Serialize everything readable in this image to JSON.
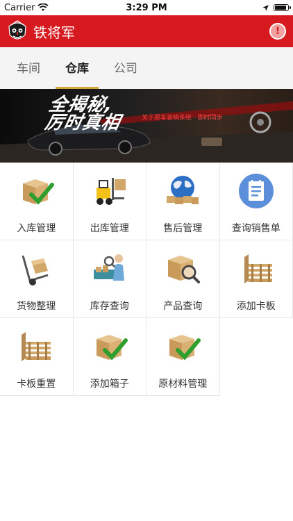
{
  "status_bar": {
    "carrier": "Carrier",
    "time": "3:29 PM"
  },
  "header": {
    "title": "铁将军",
    "alert_label": "!"
  },
  "tabs": [
    {
      "label": "车间"
    },
    {
      "label": "仓库"
    },
    {
      "label": "公司"
    }
  ],
  "banner": {
    "headline_line1": "全揭秘,",
    "headline_line2": "厉时真相",
    "subtext": "关于原车音响系统 · 即时同步"
  },
  "menu": {
    "items": [
      {
        "label": "入库管理",
        "icon": "box-check-icon"
      },
      {
        "label": "出库管理",
        "icon": "forklift-icon"
      },
      {
        "label": "售后管理",
        "icon": "globe-boxes-icon"
      },
      {
        "label": "查询销售单",
        "icon": "document-icon"
      },
      {
        "label": "货物整理",
        "icon": "hand-truck-icon"
      },
      {
        "label": "库存查询",
        "icon": "inventory-person-icon"
      },
      {
        "label": "产品查询",
        "icon": "box-magnifier-icon"
      },
      {
        "label": "添加卡板",
        "icon": "pallet-icon"
      },
      {
        "label": "卡板重置",
        "icon": "pallet-icon"
      },
      {
        "label": "添加箱子",
        "icon": "box-check-icon"
      },
      {
        "label": "原材料管理",
        "icon": "box-check-icon"
      }
    ]
  },
  "colors": {
    "header": "#d71920",
    "tab_indicator": "#d4a63c",
    "check_green": "#2e9e2e",
    "box": "#d2a86a"
  }
}
